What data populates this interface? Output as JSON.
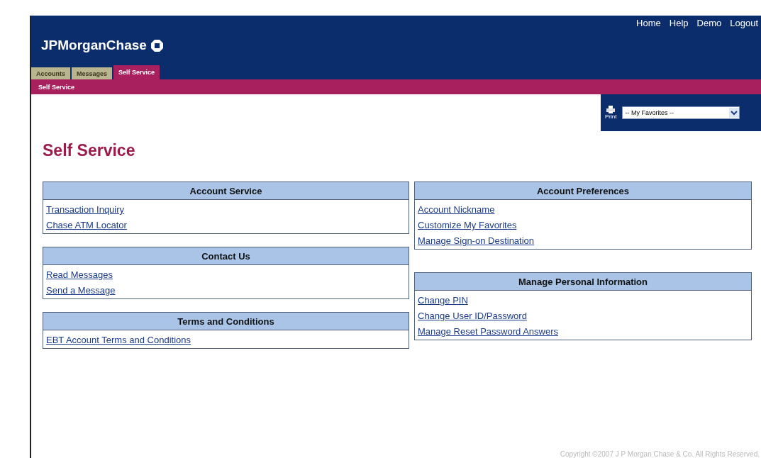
{
  "header": {
    "logo": "JPMorganChase",
    "top_links": [
      "Home",
      "Help",
      "Demo",
      "Logout"
    ]
  },
  "tabs": [
    {
      "label": "Accounts",
      "selected": false
    },
    {
      "label": "Messages",
      "selected": false
    },
    {
      "label": "Self Service",
      "selected": true
    }
  ],
  "subnav": [
    "Self Service"
  ],
  "toolbar": {
    "print": "Print",
    "favorites": {
      "value": "-- My Favorites --"
    }
  },
  "title": "Self Service",
  "columns": [
    [
      {
        "title": "Account Service",
        "links": [
          "Transaction Inquiry",
          "Chase ATM Locator"
        ]
      },
      {
        "title": "Contact Us",
        "links": [
          "Read Messages",
          "Send a Message"
        ]
      },
      {
        "title": "Terms and Conditions",
        "links": [
          "EBT Account Terms and Conditions"
        ]
      }
    ],
    [
      {
        "title": "Account Preferences",
        "links": [
          "Account Nickname",
          "Customize My Favorites",
          "Manage Sign-on Destination"
        ]
      },
      {
        "title": "Manage Personal Information",
        "links": [
          "Change PIN",
          "Change User ID/Password",
          "Manage Reset Password Answers"
        ]
      }
    ]
  ],
  "footer": "Copyright ©2007 J P Morgan Chase & Co. All Rights Reserved."
}
